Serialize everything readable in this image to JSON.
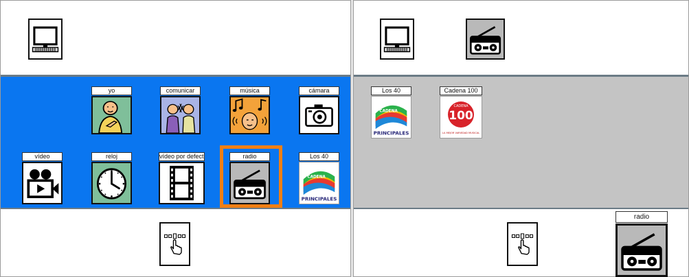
{
  "left_panel": {
    "tiles": [
      {
        "label": "yo",
        "icon": "person-pointing-self-icon"
      },
      {
        "label": "comunicar",
        "icon": "two-people-talking-icon"
      },
      {
        "label": "música",
        "icon": "music-notes-head-icon"
      },
      {
        "label": "cámara",
        "icon": "camera-icon"
      },
      {
        "label": "vídeo",
        "icon": "video-camera-icon"
      },
      {
        "label": "reloj",
        "icon": "clock-icon"
      },
      {
        "label": "vídeo por defecto",
        "icon": "film-strip-icon"
      },
      {
        "label": "radio",
        "icon": "radio-icon"
      },
      {
        "label": "Los 40",
        "icon": "los-40-principales-logo"
      }
    ],
    "selected": "radio"
  },
  "right_panel": {
    "tiles": [
      {
        "label": "Los 40",
        "icon": "los-40-principales-logo"
      },
      {
        "label": "Cadena 100",
        "icon": "cadena-100-logo"
      }
    ],
    "logo_text": {
      "cadena": "CADENA",
      "principales": "PRINCIPALES",
      "c100_top": "CADENA",
      "c100_num": "100",
      "c100_sub": "LA MEJOR VARIEDAD MUSICAL"
    },
    "current_label": "radio"
  },
  "colors": {
    "left_band": "#0a76f0",
    "right_band": "#c4c4c4",
    "selection": "#f07f14"
  }
}
